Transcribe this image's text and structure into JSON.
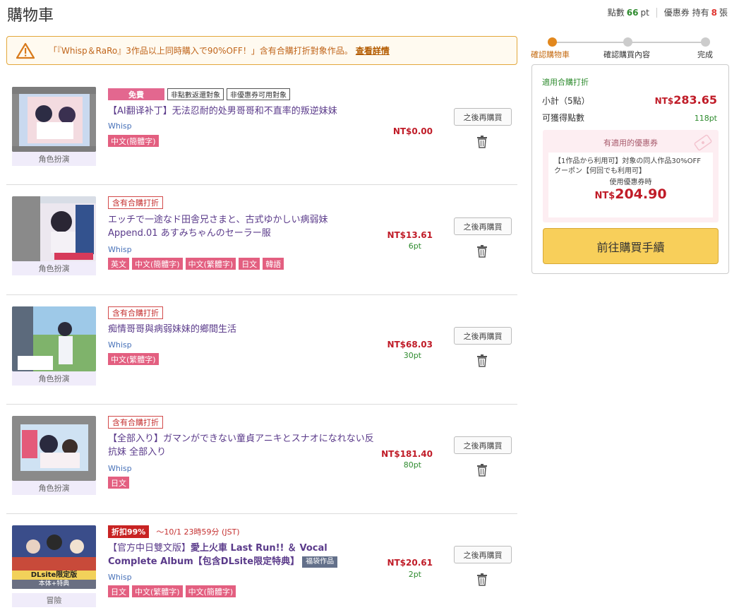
{
  "header": {
    "title": "購物車",
    "points_label": "點數",
    "points_value": "66",
    "points_unit": "pt",
    "coupon_label": "優惠券 持有",
    "coupon_value": "8",
    "coupon_unit": "張"
  },
  "notice": {
    "icon": "warning-triangle-icon",
    "text": "「『Whisp＆RaRo』3作品以上同時購入で90%OFF！」含有合購打折對象作品。",
    "link": "查看詳情"
  },
  "items": [
    {
      "category": "角色扮演",
      "badges": [
        "免費",
        "非點數返還對象",
        "非優惠券可用對象"
      ],
      "title": "【AI翻译补丁】无法忍耐的处男哥哥和不直率的叛逆妹妹",
      "maker": "Whisp",
      "langs": [
        "中文(簡體字)"
      ],
      "price": "NT$0.00",
      "points": "",
      "later": "之後再購買"
    },
    {
      "category": "角色扮演",
      "badges": [
        "含有合購打折"
      ],
      "title": "エッチで一途なド田舎兄さまと、古式ゆかしい病弱妹 Append.01 あすみちゃんのセーラー服",
      "maker": "Whisp",
      "langs": [
        "英文",
        "中文(簡體字)",
        "中文(繁體字)",
        "日文",
        "韓語"
      ],
      "price": "NT$13.61",
      "points": "6pt",
      "later": "之後再購買"
    },
    {
      "category": "角色扮演",
      "badges": [
        "含有合購打折"
      ],
      "title": "痴情哥哥與病弱妹妹的鄉間生活",
      "maker": "Whisp",
      "langs": [
        "中文(繁體字)"
      ],
      "price": "NT$68.03",
      "points": "30pt",
      "later": "之後再購買"
    },
    {
      "category": "角色扮演",
      "badges": [
        "含有合購打折"
      ],
      "title": "【全部入り】ガマンができない童貞アニキとスナオになれない反抗妹 全部入り",
      "maker": "Whisp",
      "langs": [
        "日文"
      ],
      "price": "NT$181.40",
      "points": "80pt",
      "later": "之後再購買"
    },
    {
      "category": "冒險",
      "badges": [
        "折扣99%"
      ],
      "until": "～10/1 23時59分 (JST)",
      "title_a": "【官方中日雙文版】",
      "title_b": "愛上火車 Last Run!! ＆ Vocal Complete Album【包含DLsite限定特典】",
      "bag": "福袋作品",
      "thumb_label_1": "DLsite限定版",
      "thumb_label_2": "本体+特典",
      "maker": "Whisp",
      "langs": [
        "日文",
        "中文(繁體字)",
        "中文(簡體字)"
      ],
      "price": "NT$20.61",
      "points": "2pt",
      "later": "之後再購買"
    }
  ],
  "steps": [
    "確認購物車",
    "確認購買內容",
    "完成"
  ],
  "summary": {
    "applied": "適用合購打折",
    "subtotal_label": "小計（5點）",
    "subtotal_currency": "NT$",
    "subtotal_value": "283.65",
    "points_label": "可獲得點數",
    "points_value": "118pt",
    "coupon_head": "有適用的優惠券",
    "coupon_text": "【1作品から利用可】対象の同人作品30%OFFクーポン【何回でも利用可】",
    "coupon_use": "使用優惠券時",
    "coupon_currency": "NT$",
    "coupon_price": "204.90",
    "buy_button": "前往購買手續"
  },
  "colors": {
    "accent": "#e2881e",
    "price": "#c01c28",
    "points": "#2e8b2e",
    "lang_tag": "#e35f80",
    "buy_button": "#f8cf5a"
  }
}
